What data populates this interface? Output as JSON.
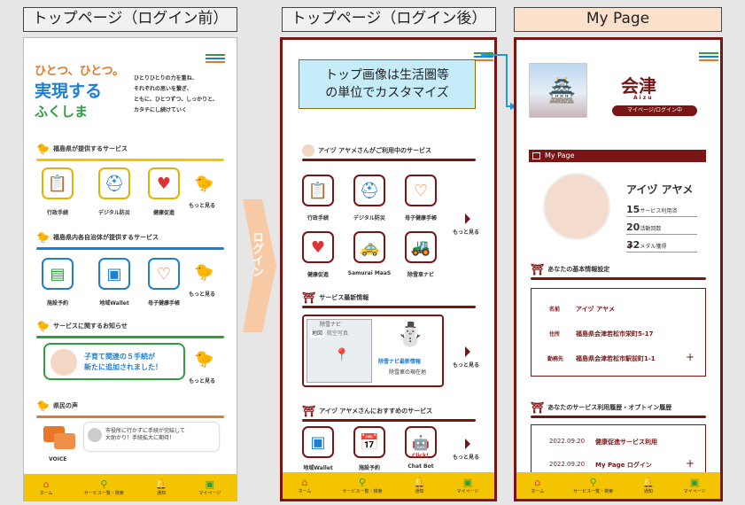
{
  "captions": {
    "before": "トップページ（ログイン前）",
    "after": "トップページ（ログイン後）",
    "mypage": "My Page"
  },
  "login_arrow": "ログイン",
  "logo": {
    "lines": [
      "ひとつ、ひとつ。",
      "実現する",
      "ふくしま"
    ]
  },
  "intro": [
    "ひとりひとりの力を重ね、",
    "それぞれの思いを繋ぎ、",
    "ともに、ひとつずつ、しっかりと、",
    "カタチにし続けていく"
  ],
  "p1": {
    "sec_pref": "福島県が提供するサービス",
    "svc_pref": [
      "行政手続",
      "デジタル防災",
      "健康促進"
    ],
    "sec_muni": "福島県内各自治体が提供するサービス",
    "svc_muni": [
      "施設予約",
      "地域Wallet",
      "母子健康手帳"
    ],
    "more": "もっと見る",
    "sec_news": "サービスに関するお知らせ",
    "news_text": [
      "子育て関連の５手続が",
      "新たに追加されました！"
    ],
    "sec_voice": "県民の声",
    "voice_label": "VOICE",
    "voice_text": [
      "市役所に行かずに手続が完結して",
      "大助かり！手続拡大に期待！"
    ]
  },
  "p2": {
    "banner": [
      "トップ画像は生活圏等",
      "の単位でカスタマイズ"
    ],
    "sec_using": "アイヅ アヤメさんがご利用中のサービス",
    "svc_using": [
      "行政手続",
      "デジタル防災",
      "母子健康手帳",
      "健康促進",
      "Samurai MaaS",
      "除雪車ナビ"
    ],
    "sec_news": "サービス最新情報",
    "news_title": "除雪ナビ最新情報",
    "news_sub": "除雪車の現在地",
    "map_title": "除雪ナビ",
    "map_tabs": [
      "地図",
      "航空写真"
    ],
    "sec_reco": "アイヅ アヤメさんにおすすめのサービス",
    "svc_reco": [
      "地域Wallet",
      "施設予約",
      "Chat Bot"
    ],
    "click": "Click!",
    "more": "もっと見る"
  },
  "p3": {
    "city": "会津",
    "city_en": "Aizu",
    "status": "マイページ/ログイン中",
    "mypage_bar": "My Page",
    "name": "アイヅ アヤメ",
    "stats": [
      {
        "num": "15",
        "label": "サービス利用済"
      },
      {
        "num": "20",
        "label": "活動回数"
      },
      {
        "num": "32",
        "label": "メダル獲得"
      }
    ],
    "plus": "+",
    "sec_basic": "あなたの基本情報設定",
    "basic": [
      {
        "k": "名前",
        "v": "アイヅ アヤメ"
      },
      {
        "k": "住所",
        "v": "福島県会津若松市栄町5-17"
      },
      {
        "k": "勤務先",
        "v": "福島県会津若松市駅前町1-1"
      }
    ],
    "sec_hist": "あなたのサービス利用履歴・オプトイン履歴",
    "hist": [
      {
        "date": "2022.09.20",
        "text": "健康促進サービス利用"
      },
      {
        "date": "2022.09.20",
        "text": "My Page ログイン"
      }
    ]
  },
  "nav": [
    "ホーム",
    "サービス一覧・検索",
    "通知",
    "マイページ"
  ],
  "colors": {
    "maroon": "#7a1515",
    "yellow": "#f5c400",
    "blue": "#1f7fd0",
    "green": "#2e9e3e",
    "orange": "#e8772a"
  }
}
